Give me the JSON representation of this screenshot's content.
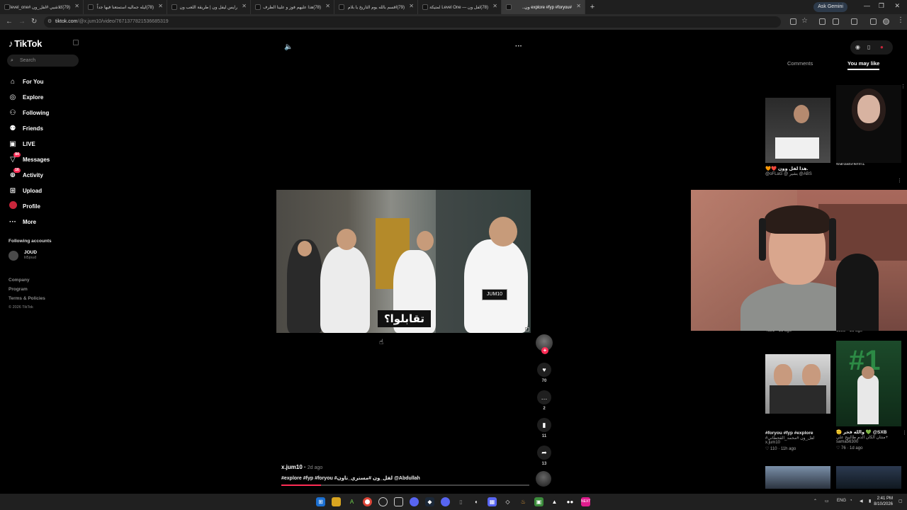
{
  "browser": {
    "tabs": [
      {
        "title": "(79)كلاشيي #لفل_ون #level_one"
      },
      {
        "title": "(78)ليله جماليه استمتعنا فيها جداً"
      },
      {
        "title": "رايس ليفل ون | طريقة اللعب ون"
      },
      {
        "title": "(78)هذا عليهم فوز و علينا الظرف"
      },
      {
        "title": "(79)اقسم بالله يوم التاريخ يا بلام"
      },
      {
        "title": "(78)لفل ون — Level One لمتيكة"
      },
      {
        "title": "#explore #fyp #foryou ون..",
        "active": true
      }
    ],
    "new_tab": "+",
    "gemini_label": "Ask Gemini",
    "url_host": "tiktok.com",
    "url_path": "/@x.jum10/video/7671377821536685319"
  },
  "sidebar": {
    "logo": "TikTok",
    "search_placeholder": "Search",
    "nav": [
      {
        "label": "For You",
        "icon": "⌂"
      },
      {
        "label": "Explore",
        "icon": "◎"
      },
      {
        "label": "Following",
        "icon": "⚇"
      },
      {
        "label": "Friends",
        "icon": "⚉"
      },
      {
        "label": "LIVE",
        "icon": "▣"
      },
      {
        "label": "Messages",
        "icon": "▽",
        "badge": "84"
      },
      {
        "label": "Activity",
        "icon": "⊕",
        "badge": "16"
      },
      {
        "label": "Upload",
        "icon": "⊞"
      },
      {
        "label": "Profile",
        "icon": ""
      },
      {
        "label": "More",
        "icon": "···"
      }
    ],
    "following_title": "Following accounts",
    "following": [
      {
        "name": "JOUD",
        "handle": "lil5joud"
      }
    ],
    "footer": [
      "Company",
      "Program",
      "Terms & Policies"
    ],
    "copyright": "© 2026 TikTok"
  },
  "video": {
    "caption": "تقابلوا؟",
    "badge_text": "JUM10",
    "author": "x.jum10",
    "age": "2d ago",
    "description": "#explore #fyp #foryou #لفل_ون #مستري_تاون @Abdullah",
    "progress": 0.16,
    "actions": [
      {
        "name": "like",
        "icon": "♥",
        "count": "70"
      },
      {
        "name": "comment",
        "icon": "…",
        "count": "2"
      },
      {
        "name": "save",
        "icon": "▮",
        "count": "11"
      },
      {
        "name": "share",
        "icon": "➦",
        "count": "13"
      }
    ]
  },
  "right_panel": {
    "tabs": [
      "Comments",
      "You may like"
    ],
    "active_tab": "You may like",
    "cards": [
      {
        "t1": ".هذا لفل وون ❤️🧡",
        "t2": "@oFLaG @ بشير @ABS",
        "t3": ""
      },
      {
        "t1": "wardalshehri1",
        "t2": "",
        "t3": ""
      },
      {
        "t1": "",
        "t2": "",
        "t3": "4131 · 1d ago"
      },
      {
        "t1": "",
        "t2": "",
        "t3": "1283 · 1d ago"
      },
      {
        "t1": "#foryou #fyp #explore",
        "t2": "#لفل_ون #محمد_القحطاني",
        "t3": "x.jum10",
        "t4": "♡ 110 · 11h ago"
      },
      {
        "t1": "SXB@ 💚 والله فخر 🫡",
        "t2": "+منتان ألكان الدم طالبيح علي",
        "t3": "sama56300",
        "t4": "♡ 76 · 1d ago"
      }
    ]
  },
  "taskbar": {
    "lang": "ENG",
    "time": "2:41 PM",
    "date": "8/10/2026"
  },
  "colors": {
    "accent": "#fe2c55",
    "background": "#000000"
  }
}
